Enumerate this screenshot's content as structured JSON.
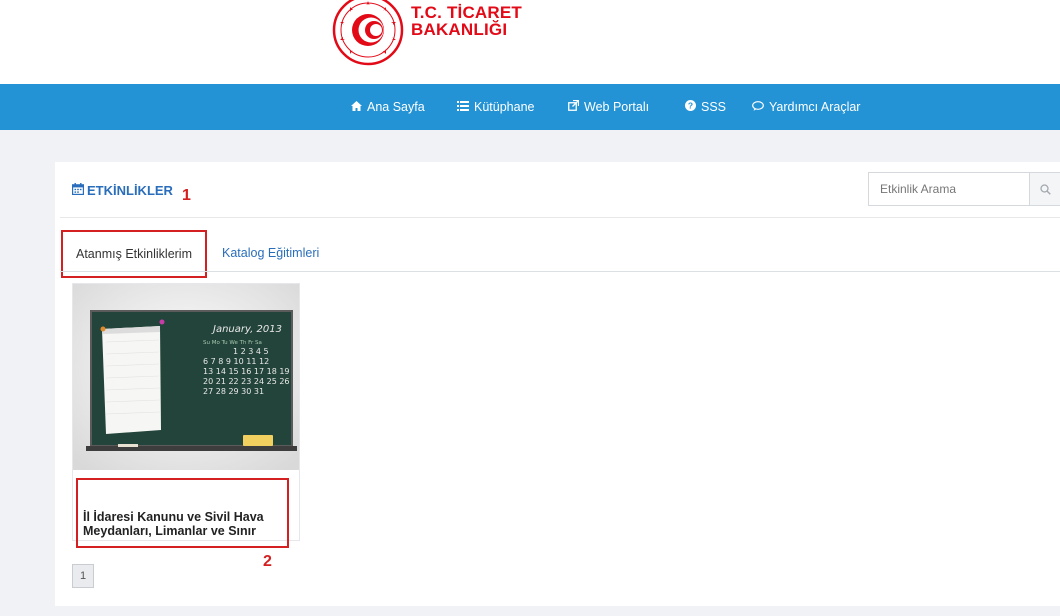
{
  "brand": {
    "line1": "T.C. TİCARET",
    "line2": "BAKANLIĞI"
  },
  "nav": [
    {
      "icon": "home-icon",
      "label": "Ana Sayfa"
    },
    {
      "icon": "list-icon",
      "label": "Kütüphane"
    },
    {
      "icon": "external-link-icon",
      "label": "Web Portalı"
    },
    {
      "icon": "question-circle-icon",
      "label": "SSS"
    },
    {
      "icon": "chat-bubble-icon",
      "label": "Yardımcı Araçlar"
    }
  ],
  "section": {
    "title": "ETKİNLİKLER",
    "icon": "calendar-icon"
  },
  "search": {
    "placeholder": "Etkinlik Arama",
    "icon": "search-icon"
  },
  "tabs": [
    {
      "label": "Atanmış Etkinliklerim",
      "active": true
    },
    {
      "label": "Katalog Eğitimleri",
      "active": false
    }
  ],
  "card": {
    "image_text": {
      "month": "January, 2013",
      "days_header": "Su Mo Tu We Th Fr Sa",
      "rows": [
        "1 2 3 4 5",
        "6 7 8 9 10 11 12",
        "13 14 15 16 17 18 19",
        "20 21 22 23 24 25 26",
        "27 28 29 30 31"
      ]
    },
    "title": "İl İdaresi Kanunu ve Sivil Hava Meydanları, Limanlar ve Sınır"
  },
  "pagination": {
    "current": "1"
  },
  "callouts": {
    "one": "1",
    "two": "2"
  },
  "colors": {
    "nav_bg": "#2393d5",
    "brand_red": "#e30a17",
    "link_blue": "#2a6ebb",
    "callout_red": "#d42020"
  }
}
